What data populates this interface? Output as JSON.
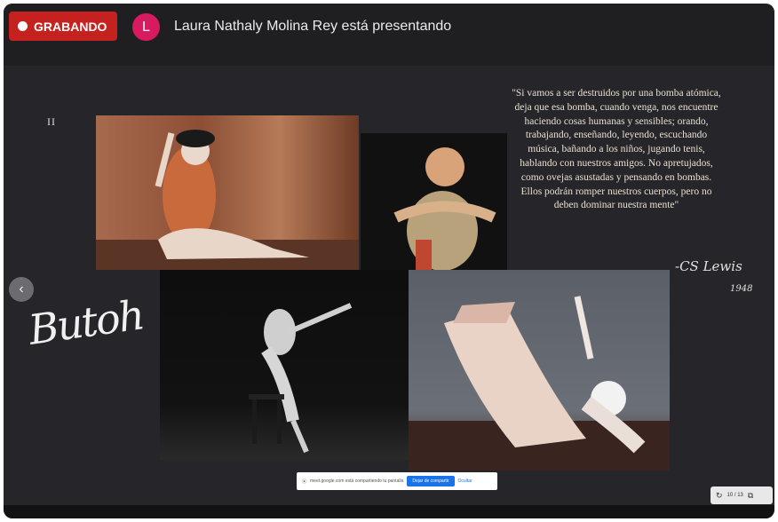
{
  "recording": {
    "label": "GRABANDO"
  },
  "presenter": {
    "avatar_letter": "L",
    "text": "Laura Nathaly Molina Rey está presentando"
  },
  "slide": {
    "page_marker": "II",
    "title_script": "Butoh",
    "quote": "\"Si vamos a ser destruidos por una bomba atómica, deja que esa bomba, cuando venga, nos encuentre haciendo cosas humanas y sensibles; orando, trabajando, enseñando, leyendo, escuchando música, bañando a los niños, jugando tenis, hablando con nuestros amigos. No apretujados, como ovejas asustadas y pensando en bombas. Ellos podrán romper nuestros cuerpos, pero no deben dominar nuestra mente\"",
    "signature": "-CS Lewis",
    "year": "1948"
  },
  "share_bar": {
    "message": "meet.google.com está compartiendo tu pantalla",
    "stop_label": "Dejar de compartir",
    "hide_label": "Ocultar"
  },
  "slide_controls": {
    "counter": "10 / 13"
  },
  "colors": {
    "record": "#c5221f",
    "avatar": "#d81b60",
    "background": "#1f1f22"
  }
}
